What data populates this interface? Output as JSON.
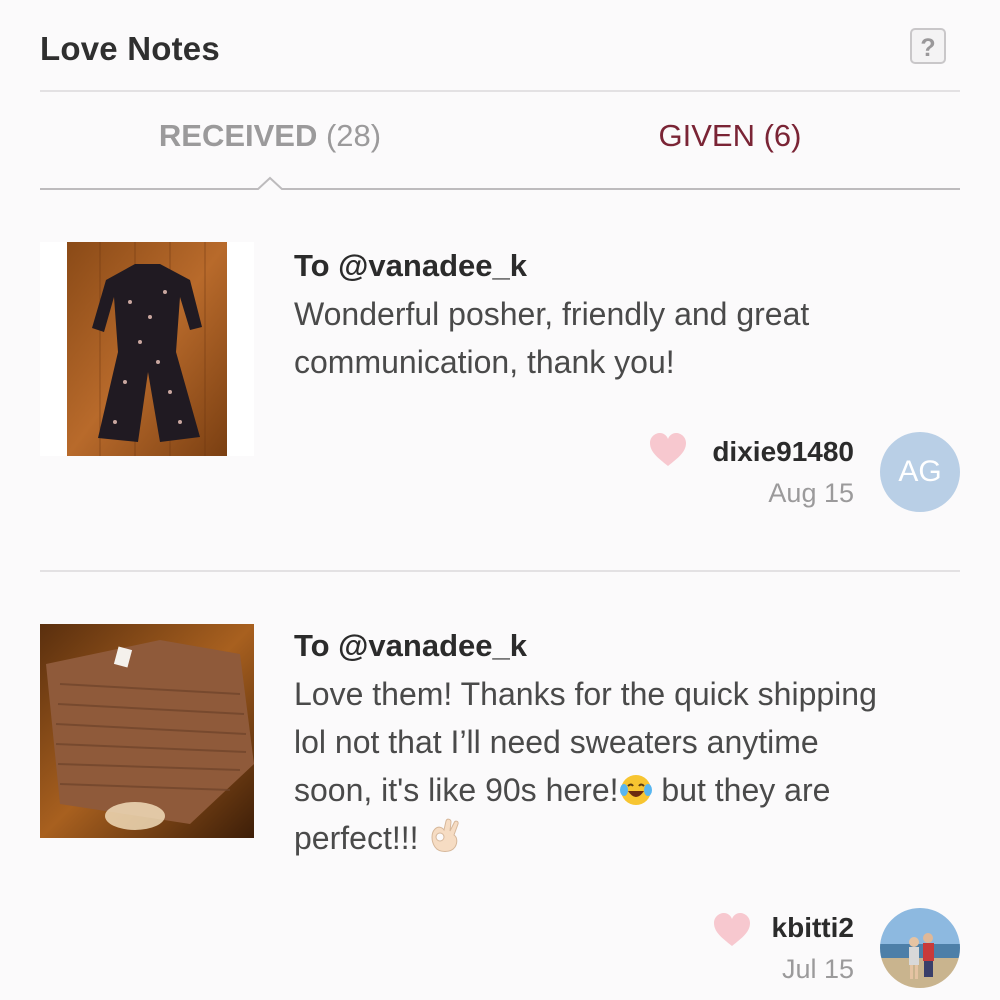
{
  "header": {
    "title": "Love Notes",
    "help_label": "?"
  },
  "tabs": {
    "received": {
      "label": "RECEIVED",
      "count": "(28)",
      "selected": true
    },
    "given": {
      "label": "GIVEN (6)"
    }
  },
  "colors": {
    "accent": "#7a2435",
    "heart": "#f7c8cf",
    "avatar_bg": "#b9cfe6",
    "divider": "#e3e1e3"
  },
  "notes": [
    {
      "to": "To @vanadee_k",
      "message": "Wonderful posher, friendly and great communication, thank you!",
      "username": "dixie91480",
      "date": "Aug 15",
      "avatar_initials": "AG",
      "heart_icon": "heart-icon",
      "thumbnail": "patterned jumpsuit on wood floor"
    },
    {
      "to": "To @vanadee_k",
      "message_parts": [
        "Love them! Thanks for the quick shipping lol not that I’ll need sweaters anytime soon, it's like 90s here!",
        " but they are perfect!!! "
      ],
      "emojis": [
        "laughing-emoji",
        "ok-hand-emoji"
      ],
      "username": "kbitti2",
      "date": "Jul 15",
      "avatar": "photo-avatar",
      "heart_icon": "heart-icon",
      "thumbnail": "brown ribbed sweater on wood floor"
    }
  ]
}
